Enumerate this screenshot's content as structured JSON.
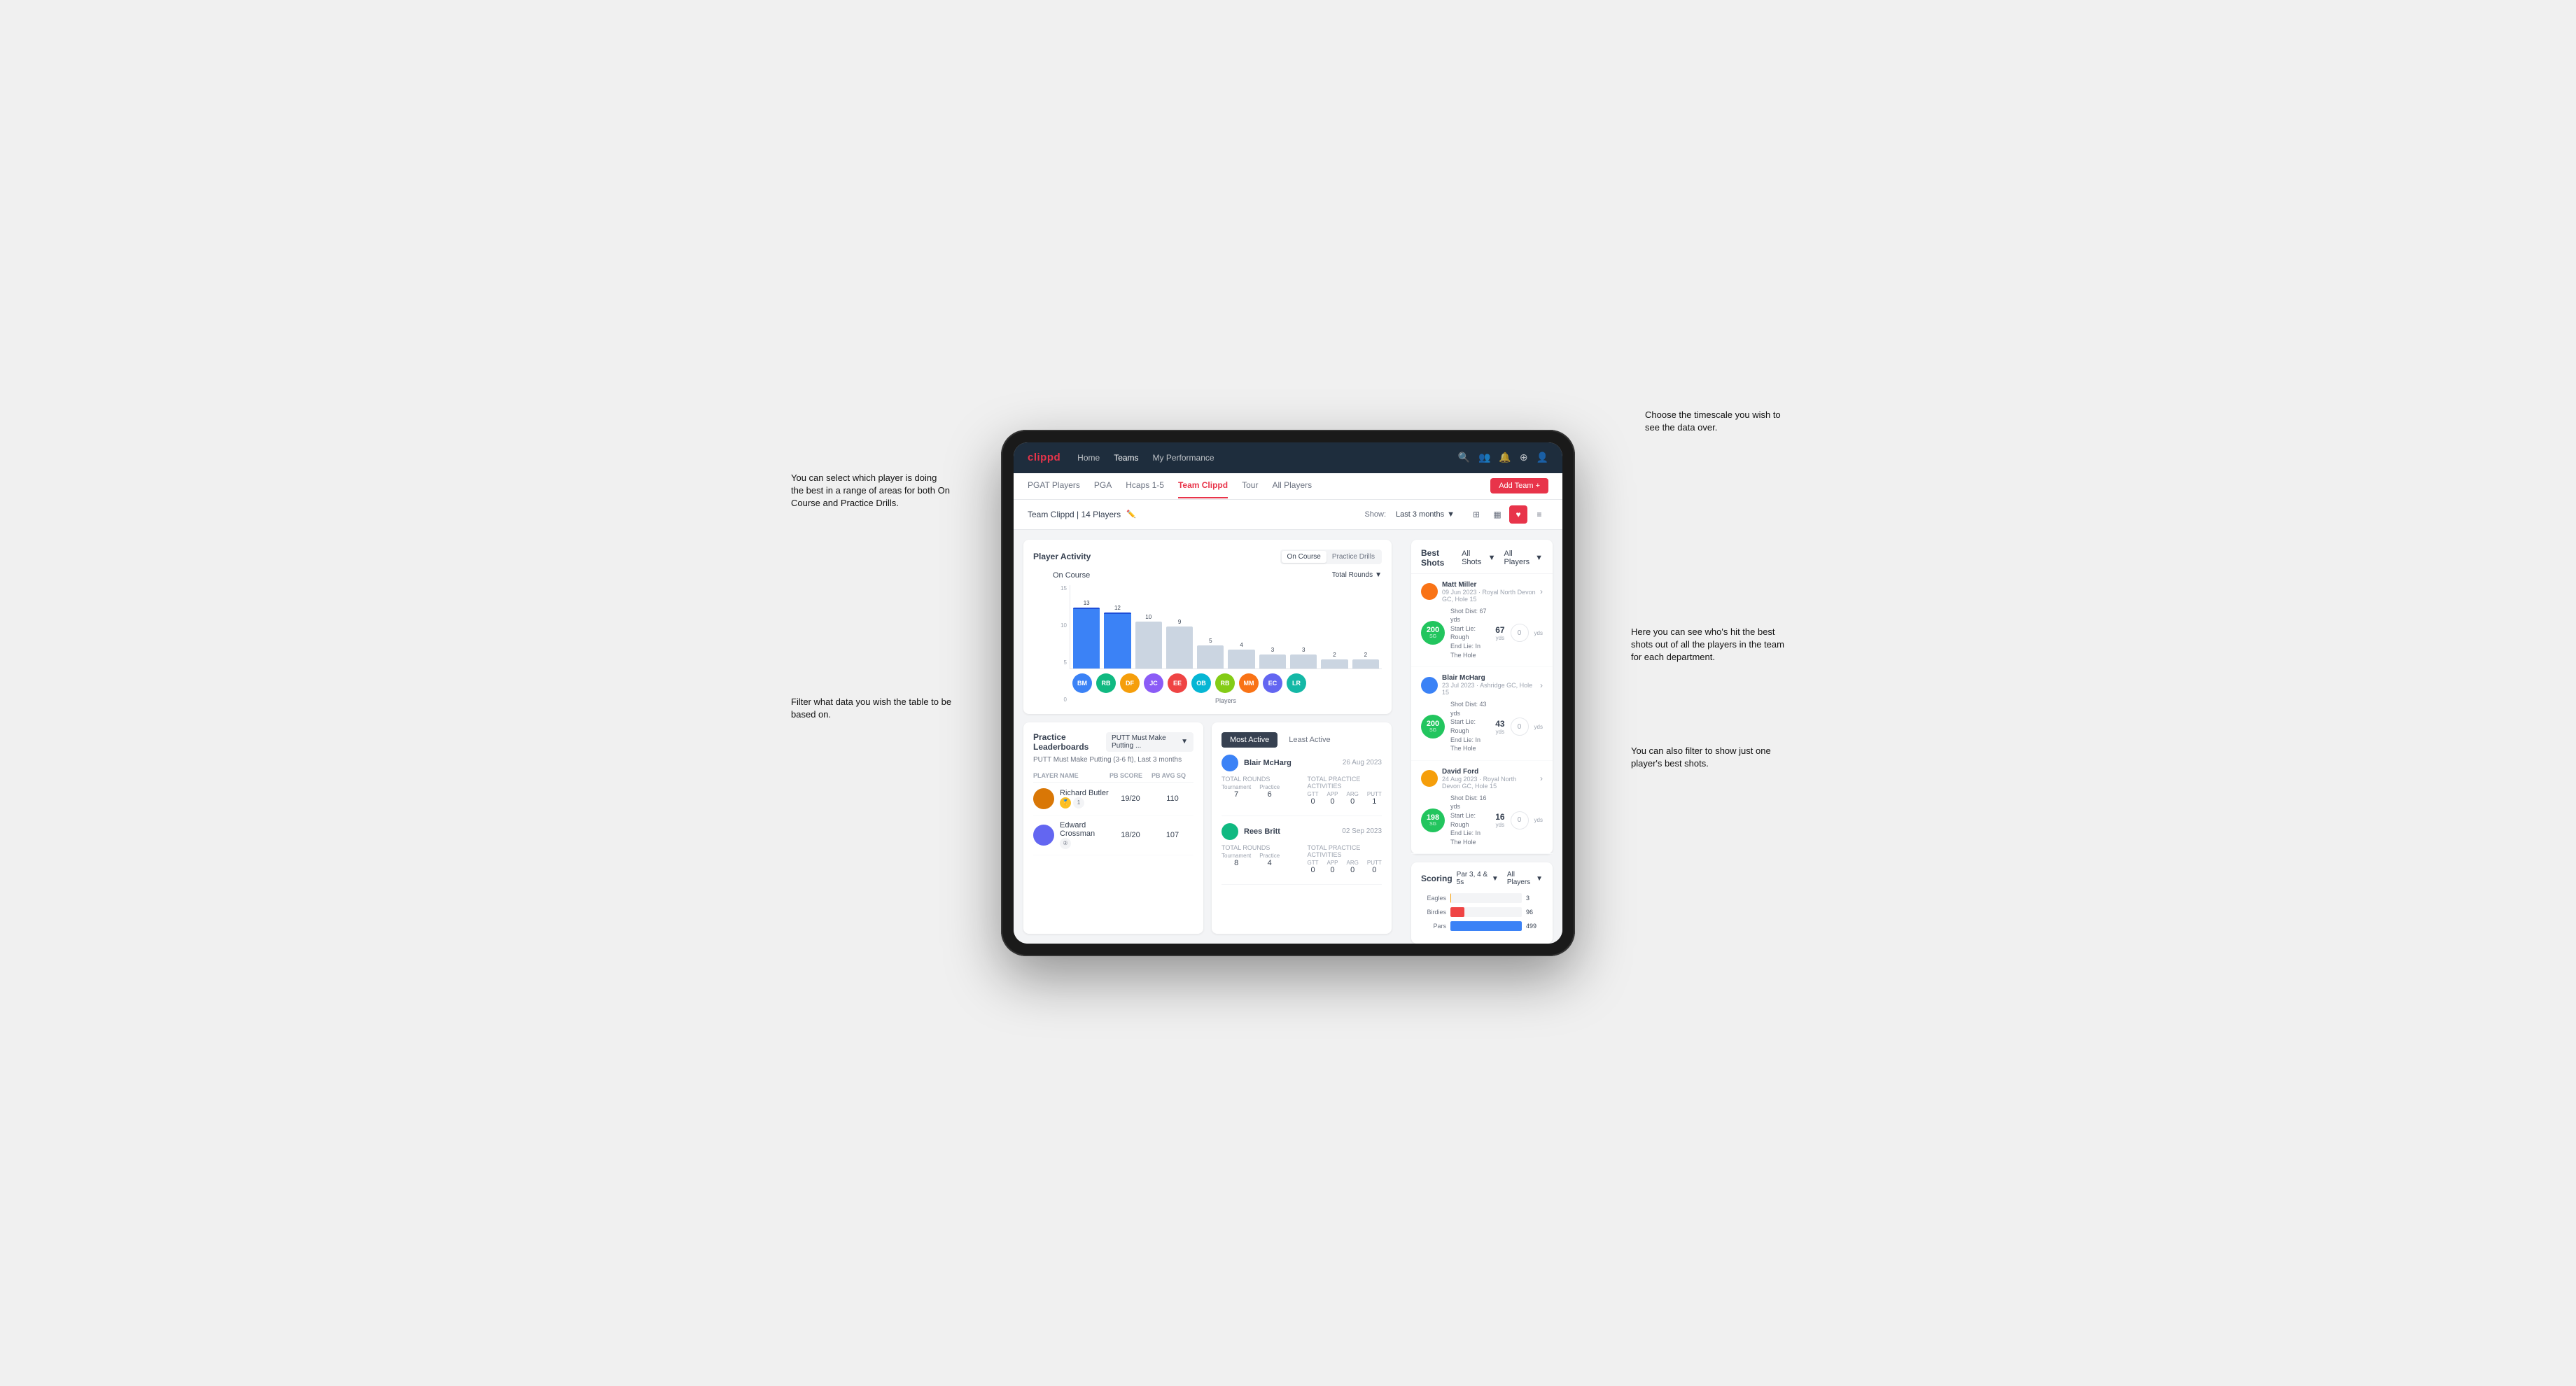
{
  "annotations": {
    "top_right": "Choose the timescale you wish to see the data over.",
    "left_top": "You can select which player is doing the best in a range of areas for both On Course and Practice Drills.",
    "left_bottom": "Filter what data you wish the table to be based on.",
    "right_mid": "Here you can see who's hit the best shots out of all the players in the team for each department.",
    "right_bottom": "You can also filter to show just one player's best shots."
  },
  "nav": {
    "logo": "clippd",
    "links": [
      "Home",
      "Teams",
      "My Performance"
    ],
    "active_link": "Teams"
  },
  "sub_nav": {
    "tabs": [
      "PGAT Players",
      "PGA",
      "Hcaps 1-5",
      "Team Clippd",
      "Tour",
      "All Players"
    ],
    "active_tab": "Team Clippd",
    "add_btn": "Add Team +"
  },
  "team_header": {
    "title": "Team Clippd | 14 Players",
    "show_label": "Show:",
    "show_value": "Last 3 months",
    "dropdown_arrow": "▼"
  },
  "player_activity": {
    "title": "Player Activity",
    "toggle_options": [
      "On Course",
      "Practice Drills"
    ],
    "active_toggle": "On Course",
    "chart": {
      "sub_title": "On Course",
      "dropdown": "Total Rounds",
      "y_labels": [
        "15",
        "10",
        "5",
        "0"
      ],
      "bars": [
        {
          "label": "B. McHarg",
          "value": 13,
          "height": 87,
          "highlight": true
        },
        {
          "label": "R. Britt",
          "value": 12,
          "height": 80,
          "highlight": true
        },
        {
          "label": "D. Ford",
          "value": 10,
          "height": 67,
          "highlight": false
        },
        {
          "label": "J. Coles",
          "value": 9,
          "height": 60,
          "highlight": false
        },
        {
          "label": "E. Ebert",
          "value": 5,
          "height": 33,
          "highlight": false
        },
        {
          "label": "O. Billingham",
          "value": 4,
          "height": 27,
          "highlight": false
        },
        {
          "label": "R. Butler",
          "value": 3,
          "height": 20,
          "highlight": false
        },
        {
          "label": "M. Miller",
          "value": 3,
          "height": 20,
          "highlight": false
        },
        {
          "label": "E. Crossman",
          "value": 2,
          "height": 13,
          "highlight": false
        },
        {
          "label": "L. Robertson",
          "value": 2,
          "height": 13,
          "highlight": false
        }
      ],
      "x_label": "Players",
      "y_axis_title": "Total Rounds"
    },
    "avatars": [
      "BM",
      "RB",
      "DF",
      "JC",
      "EE",
      "OB",
      "RB",
      "MM",
      "EC",
      "LR"
    ],
    "avatar_colors": [
      "#3b82f6",
      "#10b981",
      "#f59e0b",
      "#8b5cf6",
      "#ef4444",
      "#06b6d4",
      "#84cc16",
      "#f97316",
      "#6366f1",
      "#14b8a6"
    ]
  },
  "best_shots": {
    "title": "Best Shots",
    "shots_filter": "All Shots",
    "players_filter": "All Players",
    "items": [
      {
        "player_name": "Matt Miller",
        "date": "09 Jun 2023",
        "location": "Royal North Devon GC",
        "hole": "Hole 15",
        "score": 200,
        "sg": "SG",
        "shot_dist": "67 yds",
        "start_lie": "Rough",
        "end_lie": "In The Hole",
        "yds": 67,
        "zero": 0
      },
      {
        "player_name": "Blair McHarg",
        "date": "23 Jul 2023",
        "location": "Ashridge GC",
        "hole": "Hole 15",
        "score": 200,
        "sg": "SG",
        "shot_dist": "43 yds",
        "start_lie": "Rough",
        "end_lie": "In The Hole",
        "yds": 43,
        "zero": 0
      },
      {
        "player_name": "David Ford",
        "date": "24 Aug 2023",
        "location": "Royal North Devon GC",
        "hole": "Hole 15",
        "score": 198,
        "sg": "SG",
        "shot_dist": "16 yds",
        "start_lie": "Rough",
        "end_lie": "In The Hole",
        "yds": 16,
        "zero": 0
      }
    ]
  },
  "scoring": {
    "title": "Scoring",
    "filter": "Par 3, 4 & 5s",
    "players_filter": "All Players",
    "bars": [
      {
        "label": "Eagles",
        "value": 3,
        "color": "#f59e0b",
        "width_pct": 1
      },
      {
        "label": "Birdies",
        "value": 96,
        "color": "#ef4444",
        "width_pct": 20
      },
      {
        "label": "Pars",
        "value": 499,
        "color": "#3b82f6",
        "width_pct": 100
      }
    ]
  },
  "practice_leaderboards": {
    "title": "Practice Leaderboards",
    "dropdown": "PUTT Must Make Putting ...",
    "subtitle": "PUTT Must Make Putting (3-6 ft), Last 3 months",
    "columns": [
      "PLAYER NAME",
      "PB SCORE",
      "PB AVG SQ"
    ],
    "players": [
      {
        "name": "Richard Butler",
        "rank": 1,
        "rank_medal": "🥇",
        "pb_score": "19/20",
        "pb_avg_sq": "110",
        "rank_color": "gold"
      },
      {
        "name": "Edward Crossman",
        "rank": 2,
        "rank_medal": "②",
        "pb_score": "18/20",
        "pb_avg_sq": "107",
        "rank_color": "silver"
      }
    ]
  },
  "most_active": {
    "tabs": [
      "Most Active",
      "Least Active"
    ],
    "active_tab": "Most Active",
    "players": [
      {
        "name": "Blair McHarg",
        "date": "26 Aug 2023",
        "total_rounds_label": "Total Rounds",
        "tournament": "7",
        "practice": "6",
        "total_practice_label": "Total Practice Activities",
        "gtt": "0",
        "app": "0",
        "arg": "0",
        "putt": "1"
      },
      {
        "name": "Rees Britt",
        "date": "02 Sep 2023",
        "total_rounds_label": "Total Rounds",
        "tournament": "8",
        "practice": "4",
        "total_practice_label": "Total Practice Activities",
        "gtt": "0",
        "app": "0",
        "arg": "0",
        "putt": "0"
      }
    ]
  },
  "icons": {
    "search": "🔍",
    "users": "👥",
    "bell": "🔔",
    "circle_plus": "⊕",
    "user_circle": "👤",
    "edit": "✏️",
    "chevron_down": "▼",
    "chevron_right": "›",
    "grid": "⊞",
    "heart": "♥",
    "list": "≡"
  }
}
